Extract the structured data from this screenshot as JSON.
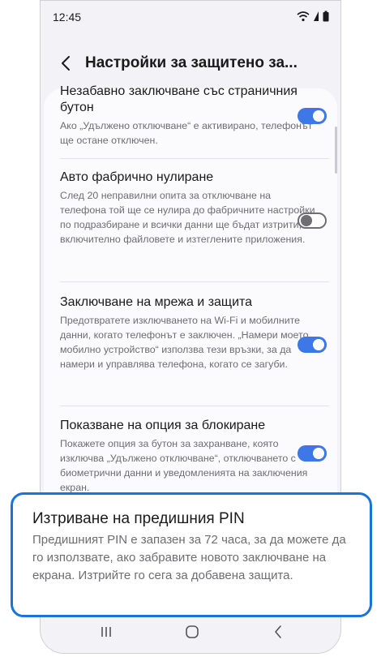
{
  "status_bar": {
    "time": "12:45",
    "icons": [
      "wifi-icon",
      "signal-icon",
      "battery-icon"
    ]
  },
  "header": {
    "title": "Настройки за защитено за..."
  },
  "settings": [
    {
      "title": "Незабавно заключване със страничния бутон",
      "description": "Ако „Удължено отключване“ е активирано, телефонът ще остане отключен.",
      "enabled": true
    },
    {
      "title": "Авто фабрично нулиране",
      "description": "След 20 неправилни опита за отключване на телефона той ще се нулира до фабричните настройки по подразбиране и всички данни ще бъдат изтрити, включително файловете и изтеглените приложения.",
      "enabled": false
    },
    {
      "title": "Заключване на мрежа и защита",
      "description": "Предотвратете изключването на Wi-Fi и мобилните данни, когато телефонът е заключен. „Намери моето мобилно устройство“ използва тези връзки, за да намери и управлява телефона, когато се загуби.",
      "enabled": true
    },
    {
      "title": "Показване на опция за блокиране",
      "description": "Покажете опция за бутон за захранване, която изключва „Удължено отключване“, отключването с биометрични данни и уведомленията на заключения екран.",
      "enabled": true
    }
  ],
  "popup": {
    "title": "Изтриване на предишния PIN",
    "description": "Предишният PIN е запазен за 72 часа, за да можете да го използвате, ако забравите новото заключване на екрана. Изтрийте го сега за добавена защита."
  },
  "nav_bar": {
    "buttons": [
      "recents-icon",
      "home-icon",
      "back-icon"
    ]
  },
  "colors": {
    "accent": "#3e77e6",
    "highlight_border": "#1a73d9",
    "background": "#f3f2f7"
  }
}
